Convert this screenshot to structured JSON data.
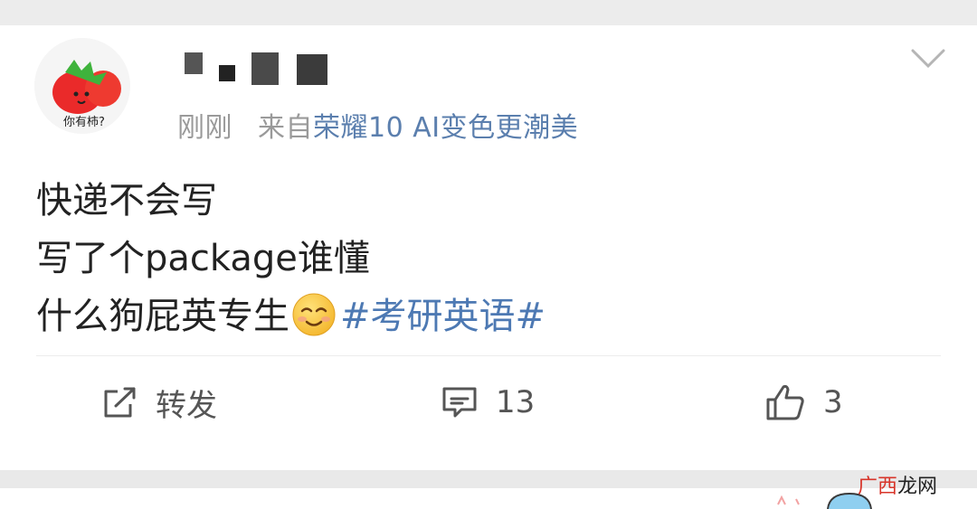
{
  "post": {
    "time": "刚刚",
    "source_prefix": "来自",
    "source_device": "荣耀10 AI变色更潮美",
    "content": {
      "line1": "快递不会写",
      "line2": "写了个package谁懂",
      "line3_text": "什么狗屁英专生",
      "hashtag": "#考研英语#"
    },
    "avatar_caption": "你有柿?"
  },
  "actions": {
    "repost_label": "转发",
    "comment_count": "13",
    "like_count": "3"
  },
  "watermark": {
    "part_a": "广西",
    "part_b": "龙网"
  },
  "colors": {
    "link": "#4d79b3",
    "meta": "#9a9a9a",
    "text": "#222222",
    "card": "#ffffff",
    "background": "#ebebeb"
  },
  "icons": [
    "tomato-avatar",
    "chevron-down-icon",
    "smile-emoji-icon",
    "repost-icon",
    "comment-icon",
    "like-icon"
  ]
}
